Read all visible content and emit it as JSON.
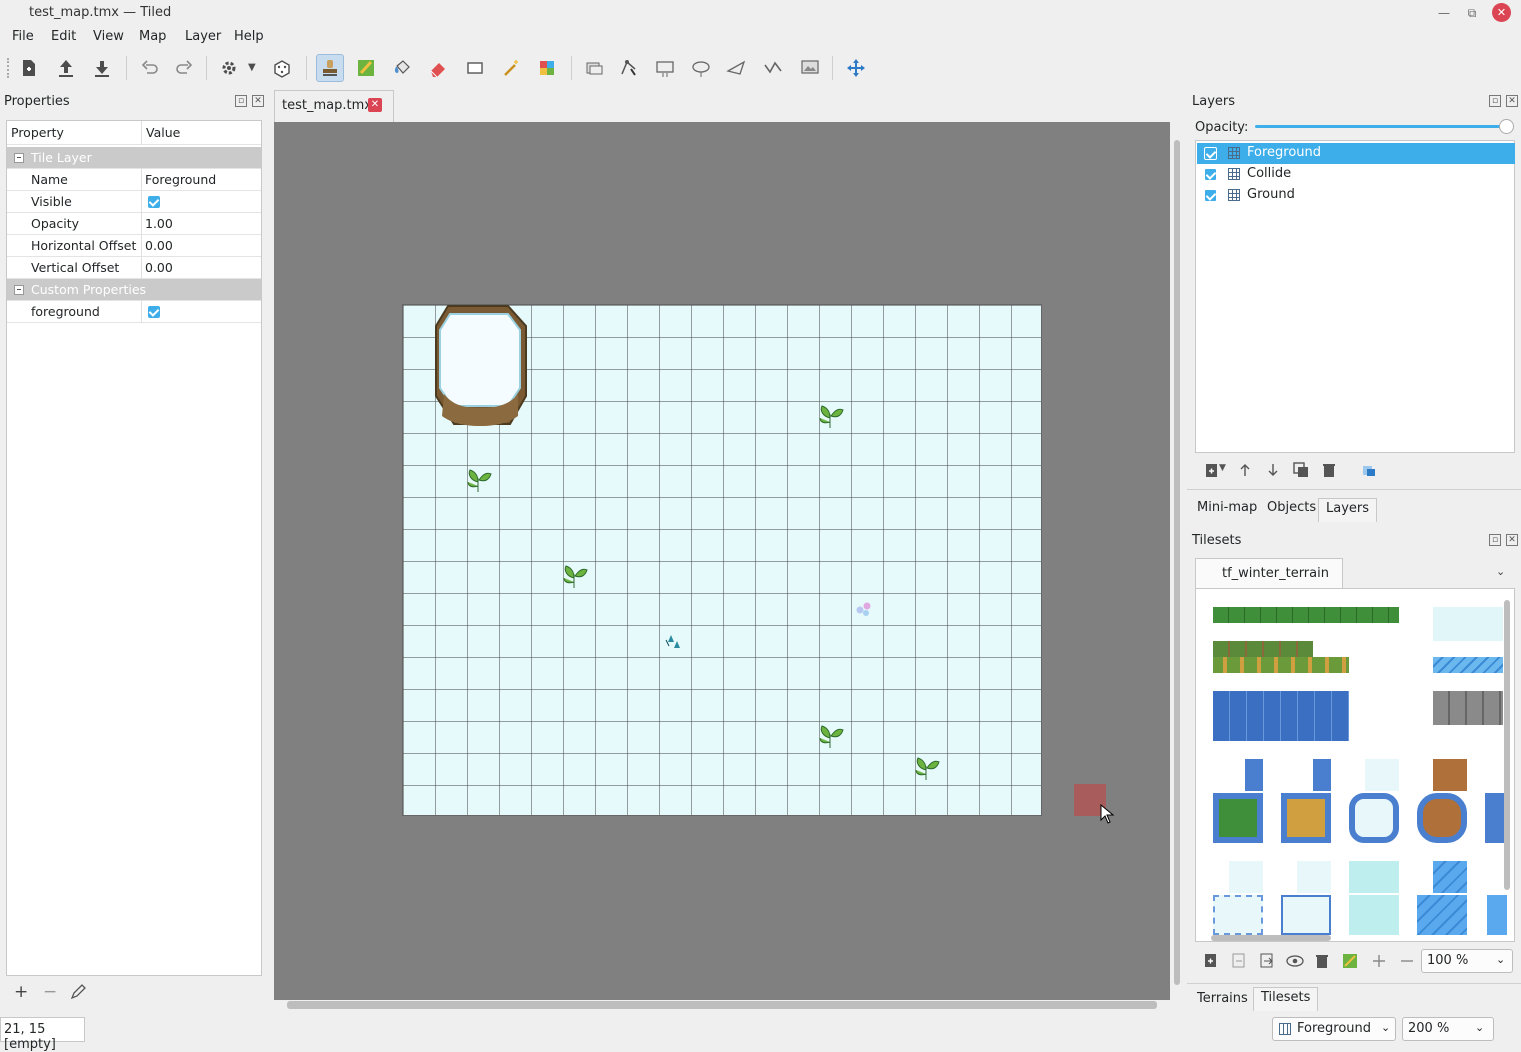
{
  "window": {
    "title": "test_map.tmx — Tiled"
  },
  "menu": [
    "File",
    "Edit",
    "View",
    "Map",
    "Layer",
    "Help"
  ],
  "properties": {
    "title": "Properties",
    "headers": {
      "property": "Property",
      "value": "Value"
    },
    "groups": {
      "tile_layer": "Tile Layer",
      "custom": "Custom Properties"
    },
    "rows": {
      "name": {
        "k": "Name",
        "v": "Foreground"
      },
      "visible": {
        "k": "Visible",
        "checked": true
      },
      "opacity": {
        "k": "Opacity",
        "v": "1.00"
      },
      "hoffset": {
        "k": "Horizontal Offset",
        "v": "0.00"
      },
      "voffset": {
        "k": "Vertical Offset",
        "v": "0.00"
      }
    },
    "custom_rows": {
      "foreground": {
        "k": "foreground",
        "checked": true
      }
    },
    "add": "+",
    "remove": "−"
  },
  "document_tab": {
    "label": "test_map.tmx"
  },
  "layers": {
    "title": "Layers",
    "opacity_label": "Opacity:",
    "opacity": 1.0,
    "items": [
      {
        "name": "Foreground",
        "visible": true,
        "selected": true
      },
      {
        "name": "Collide",
        "visible": true,
        "selected": false
      },
      {
        "name": "Ground",
        "visible": true,
        "selected": false
      }
    ]
  },
  "right_tabs": [
    "Mini-map",
    "Objects",
    "Layers"
  ],
  "tilesets": {
    "title": "Tilesets",
    "active_tab": "tf_winter_terrain",
    "zoom": "100 %"
  },
  "bottom_tabs": [
    "Terrains",
    "Tilesets"
  ],
  "status": {
    "coords": "21, 15 [empty]",
    "layer": "Foreground",
    "zoom": "200 %"
  },
  "colors": {
    "accent": "#3daee9",
    "canvas_bg": "#808080",
    "map_bg": "#e6fafb",
    "close": "#da4453"
  }
}
